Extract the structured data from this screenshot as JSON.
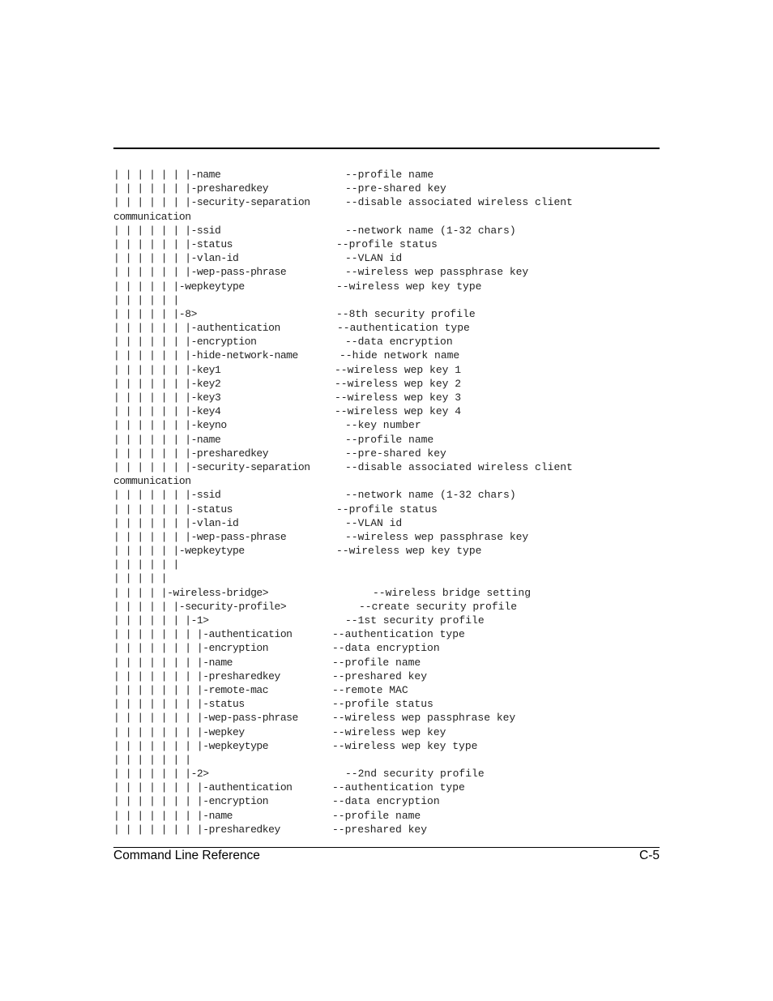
{
  "document": {
    "footer": {
      "title": "Command Line Reference",
      "page": "C-5"
    },
    "lines": [
      {
        "tree": "| | | | | | |-name",
        "desc": "--profile name",
        "col": 286
      },
      {
        "tree": "| | | | | | |-presharedkey",
        "desc": "--pre-shared key",
        "col": 286
      },
      {
        "tree": "| | | | | | |-security-separation",
        "desc": "--disable associated wireless client",
        "col": 286
      },
      {
        "tree": "communication",
        "desc": "",
        "col": 286
      },
      {
        "tree": "| | | | | | |-ssid",
        "desc": "--network name (1-32 chars)",
        "col": 286
      },
      {
        "tree": "| | | | | | |-status",
        "desc": "--profile status",
        "col": 275
      },
      {
        "tree": "| | | | | | |-vlan-id",
        "desc": "--VLAN id",
        "col": 286
      },
      {
        "tree": "| | | | | | |-wep-pass-phrase",
        "desc": "--wireless wep passphrase key",
        "col": 286
      },
      {
        "tree": "| | | | | |-wepkeytype",
        "desc": "--wireless wep key type",
        "col": 275
      },
      {
        "tree": "| | | | | |",
        "desc": "",
        "col": 286
      },
      {
        "tree": "| | | | | |-8>",
        "desc": "--8th security profile",
        "col": 275
      },
      {
        "tree": "| | | | | | |-authentication",
        "desc": "--authentication type",
        "col": 276
      },
      {
        "tree": "| | | | | | |-encryption",
        "desc": "--data encryption",
        "col": 286
      },
      {
        "tree": "| | | | | | |-hide-network-name",
        "desc": "--hide network name",
        "col": 279
      },
      {
        "tree": "| | | | | | |-key1",
        "desc": "--wireless wep key 1",
        "col": 273
      },
      {
        "tree": "| | | | | | |-key2",
        "desc": "--wireless wep key 2",
        "col": 273
      },
      {
        "tree": "| | | | | | |-key3",
        "desc": "--wireless wep key 3",
        "col": 273
      },
      {
        "tree": "| | | | | | |-key4",
        "desc": "--wireless wep key 4",
        "col": 273
      },
      {
        "tree": "| | | | | | |-keyno",
        "desc": "--key number",
        "col": 286
      },
      {
        "tree": "| | | | | | |-name",
        "desc": "--profile name",
        "col": 286
      },
      {
        "tree": "| | | | | | |-presharedkey",
        "desc": "--pre-shared key",
        "col": 286
      },
      {
        "tree": "| | | | | | |-security-separation",
        "desc": "--disable associated wireless client",
        "col": 286
      },
      {
        "tree": "communication",
        "desc": "",
        "col": 286
      },
      {
        "tree": "| | | | | | |-ssid",
        "desc": "--network name (1-32 chars)",
        "col": 286
      },
      {
        "tree": "| | | | | | |-status",
        "desc": "--profile status",
        "col": 275
      },
      {
        "tree": "| | | | | | |-vlan-id",
        "desc": "--VLAN id",
        "col": 286
      },
      {
        "tree": "| | | | | | |-wep-pass-phrase",
        "desc": "--wireless wep passphrase key",
        "col": 286
      },
      {
        "tree": "| | | | | |-wepkeytype",
        "desc": "--wireless wep key type",
        "col": 275
      },
      {
        "tree": "| | | | | |",
        "desc": "",
        "col": 286
      },
      {
        "tree": "| | | | |",
        "desc": "",
        "col": 286
      },
      {
        "tree": "| | | | |-wireless-bridge>",
        "desc": "--wireless bridge setting",
        "col": 320
      },
      {
        "tree": "| | | | | |-security-profile>",
        "desc": "--create security profile",
        "col": 303
      },
      {
        "tree": "| | | | | | |-1>",
        "desc": "--1st security profile",
        "col": 286
      },
      {
        "tree": "| | | | | | | |-authentication",
        "desc": "--authentication type",
        "col": 270
      },
      {
        "tree": "| | | | | | | |-encryption",
        "desc": "--data encryption",
        "col": 270
      },
      {
        "tree": "| | | | | | | |-name",
        "desc": "--profile name",
        "col": 270
      },
      {
        "tree": "| | | | | | | |-presharedkey",
        "desc": "--preshared key",
        "col": 270
      },
      {
        "tree": "| | | | | | | |-remote-mac",
        "desc": "--remote MAC",
        "col": 270
      },
      {
        "tree": "| | | | | | | |-status",
        "desc": "--profile status",
        "col": 270
      },
      {
        "tree": "| | | | | | | |-wep-pass-phrase",
        "desc": "--wireless wep passphrase key",
        "col": 270
      },
      {
        "tree": "| | | | | | | |-wepkey",
        "desc": "--wireless wep key",
        "col": 270
      },
      {
        "tree": "| | | | | | | |-wepkeytype",
        "desc": "--wireless wep key type",
        "col": 270
      },
      {
        "tree": "| | | | | | |",
        "desc": "",
        "col": 286
      },
      {
        "tree": "| | | | | | |-2>",
        "desc": "--2nd security profile",
        "col": 286
      },
      {
        "tree": "| | | | | | | |-authentication",
        "desc": "--authentication type",
        "col": 270
      },
      {
        "tree": "| | | | | | | |-encryption",
        "desc": "--data encryption",
        "col": 270
      },
      {
        "tree": "| | | | | | | |-name",
        "desc": "--profile name",
        "col": 270
      },
      {
        "tree": "| | | | | | | |-presharedkey",
        "desc": "--preshared key",
        "col": 270
      }
    ]
  }
}
